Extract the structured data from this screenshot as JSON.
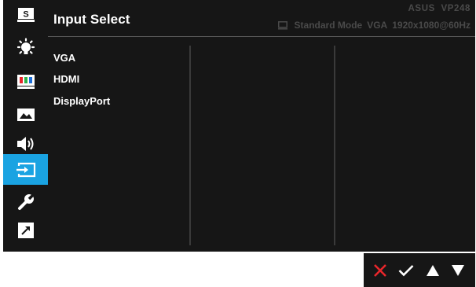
{
  "header": {
    "title": "Input Select",
    "model": "ASUS  VP248",
    "mode": "Standard Mode",
    "input": "VGA",
    "resolution": "1920x1080@60Hz"
  },
  "sidebar": {
    "items": [
      {
        "name": "splendid-icon",
        "glyph": "S"
      },
      {
        "name": "blue-light-filter-icon"
      },
      {
        "name": "color-icon"
      },
      {
        "name": "image-icon"
      },
      {
        "name": "sound-icon"
      },
      {
        "name": "input-select-icon",
        "active": true
      },
      {
        "name": "system-setup-icon"
      },
      {
        "name": "shortcut-icon"
      }
    ],
    "active_color": "#1aa3e2"
  },
  "inputs": {
    "options": [
      "VGA",
      "HDMI",
      "DisplayPort"
    ]
  },
  "nav": {
    "buttons": [
      "close-icon",
      "confirm-icon",
      "up-icon",
      "down-icon"
    ],
    "close_color": "#e8262b"
  }
}
